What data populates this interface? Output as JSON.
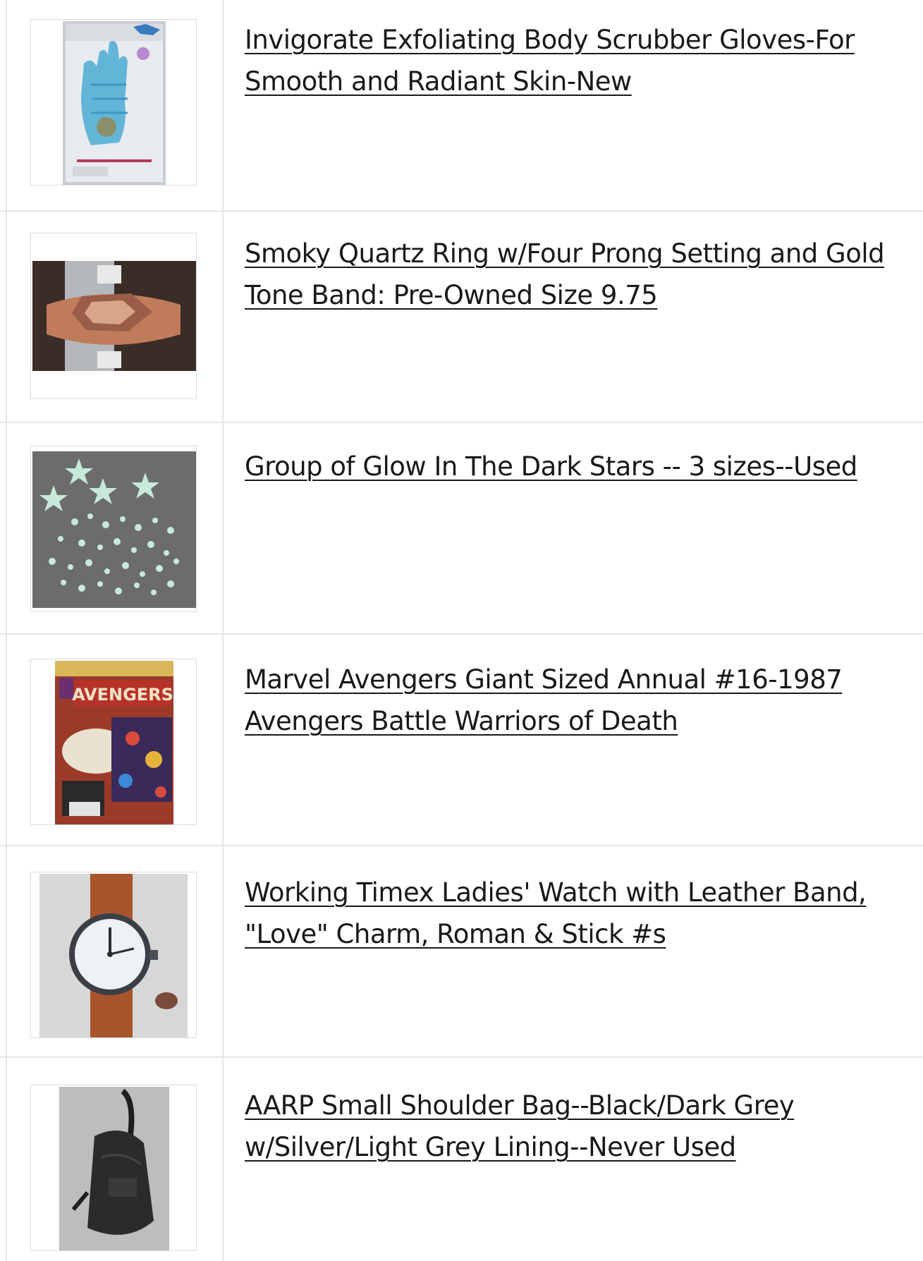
{
  "listings": [
    {
      "title": "Invigorate Exfoliating Body Scrubber Gloves-For Smooth and Radiant Skin-New",
      "image": "exfoliating-gloves-package-photo"
    },
    {
      "title": "Smoky Quartz Ring w/Four Prong Setting and Gold Tone Band: Pre-Owned Size 9.75",
      "image": "smoky-quartz-ring-photo"
    },
    {
      "title": "Group of Glow In The Dark Stars -- 3 sizes--Used",
      "image": "glow-stars-photo"
    },
    {
      "title": "Marvel Avengers Giant Sized Annual #16-1987 Avengers Battle Warriors of Death",
      "image": "avengers-comic-cover-photo",
      "cover_text": "AVENGERS"
    },
    {
      "title": "Working Timex Ladies' Watch with Leather Band, \"Love\" Charm, Roman & Stick #s",
      "image": "timex-watch-photo"
    },
    {
      "title": "AARP Small Shoulder Bag--Black/Dark Grey w/Silver/Light Grey Lining--Never Used",
      "image": "shoulder-bag-photo"
    }
  ],
  "colors": {
    "divider": "#e6e6e6",
    "title_text": "#191919"
  }
}
